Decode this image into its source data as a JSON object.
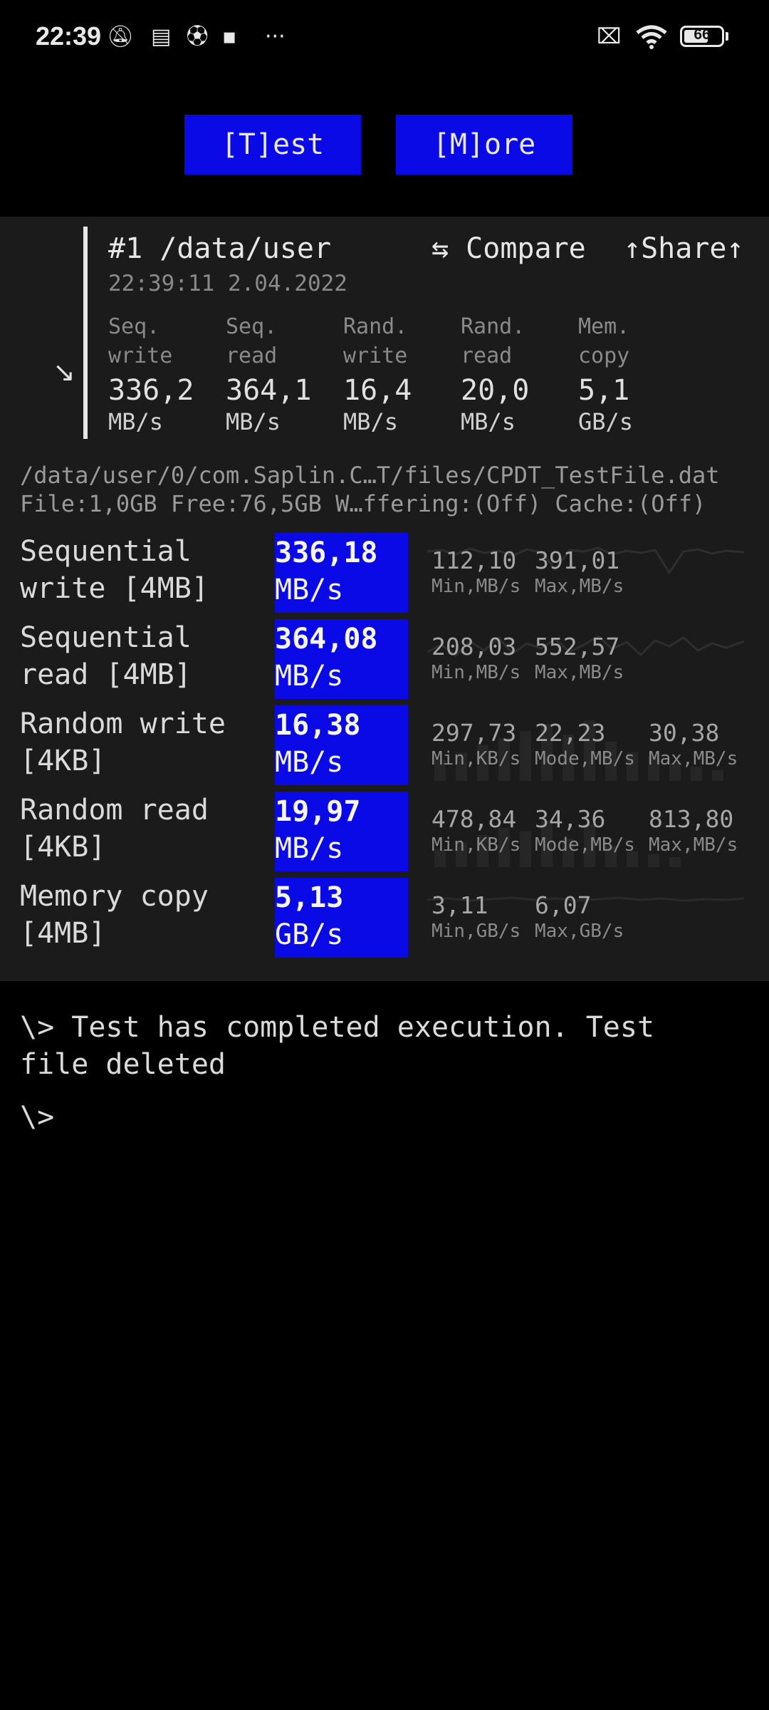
{
  "status_bar": {
    "time": "22:39",
    "left_icons": [
      "muted-bell-icon",
      "calendar-icon",
      "soccer-ball-icon",
      "chat-icon",
      "more-dots-icon"
    ],
    "right_icons": [
      "no-sim-icon",
      "wifi-icon",
      "battery-icon"
    ],
    "battery": "66",
    "battery_level": 0.66
  },
  "buttons": {
    "test": "[T]est",
    "more": "[M]ore"
  },
  "summary": {
    "title": "#1 /data/user",
    "compare": "⇆ Compare",
    "share": "↑Share↑",
    "timestamp": "22:39:11 2.04.2022",
    "expand_glyph": "↘",
    "columns": [
      {
        "label_1": "Seq.",
        "label_2": "write",
        "value": "336,2",
        "unit": "MB/s"
      },
      {
        "label_1": "Seq.",
        "label_2": "read",
        "value": "364,1",
        "unit": "MB/s"
      },
      {
        "label_1": "Rand.",
        "label_2": "write",
        "value": "16,4",
        "unit": "MB/s"
      },
      {
        "label_1": "Rand.",
        "label_2": "read",
        "value": "20,0",
        "unit": "MB/s"
      },
      {
        "label_1": "Mem.",
        "label_2": "copy",
        "value": "5,1",
        "unit": "GB/s"
      }
    ]
  },
  "info": {
    "path": "/data/user/0/com.Saplin.C…T/files/CPDT_TestFile.dat",
    "details": "File:1,0GB Free:76,5GB W…ffering:(Off) Cache:(Off)"
  },
  "results": [
    {
      "label_1": "Sequential",
      "label_2": "write [4MB]",
      "value": "336,18",
      "unit": "MB/s",
      "stats": [
        {
          "value": "112,10",
          "label": "Min,MB/s"
        },
        {
          "value": "391,01",
          "label": "Max,MB/s"
        }
      ]
    },
    {
      "label_1": "Sequential",
      "label_2": "read [4MB]",
      "value": "364,08",
      "unit": "MB/s",
      "stats": [
        {
          "value": "208,03",
          "label": "Min,MB/s"
        },
        {
          "value": "552,57",
          "label": "Max,MB/s"
        }
      ]
    },
    {
      "label_1": "Random write",
      "label_2": "[4KB]",
      "value": "16,38",
      "unit": "MB/s",
      "stats": [
        {
          "value": "297,73",
          "label": "Min,KB/s"
        },
        {
          "value": "22,23",
          "label": "Mode,MB/s"
        },
        {
          "value": "30,38",
          "label": "Max,MB/s"
        }
      ]
    },
    {
      "label_1": "Random read",
      "label_2": "[4KB]",
      "value": "19,97",
      "unit": "MB/s",
      "stats": [
        {
          "value": "478,84",
          "label": "Min,KB/s"
        },
        {
          "value": "34,36",
          "label": "Mode,MB/s"
        },
        {
          "value": "813,80",
          "label": "Max,MB/s"
        }
      ]
    },
    {
      "label_1": "Memory copy",
      "label_2": "[4MB]",
      "value": "5,13",
      "unit": "GB/s",
      "stats": [
        {
          "value": "3,11",
          "label": "Min,GB/s"
        },
        {
          "value": "6,07",
          "label": "Max,GB/s"
        }
      ]
    }
  ],
  "console": {
    "line_1a": "\\> Test has completed execution. Test",
    "line_1b": "file deleted",
    "prompt": "\\>"
  },
  "colors": {
    "accent": "#0a0ae6",
    "panel": "#1b1b1b",
    "background": "#000000"
  }
}
